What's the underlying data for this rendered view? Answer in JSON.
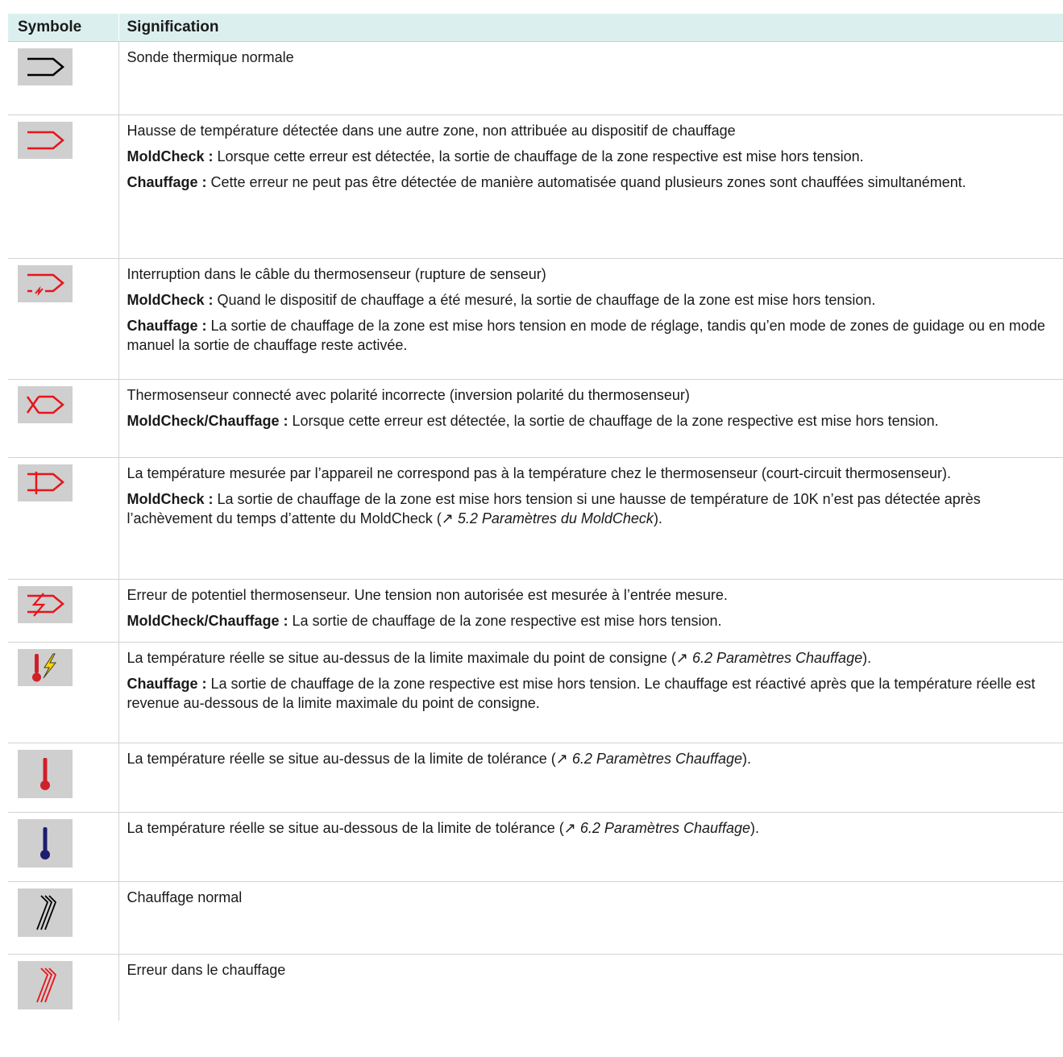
{
  "header": {
    "symbol": "Symbole",
    "meaning": "Signification"
  },
  "rows": [
    {
      "icon": "thermocouple-normal-icon",
      "color": "#000000",
      "text": "Sonde thermique normale"
    },
    {
      "icon": "thermocouple-red-icon",
      "color": "#e8141b",
      "text": "Hausse de température détectée dans une autre zone, non attribuée au dispositif de chauffage",
      "p2_label": "MoldCheck :",
      "p2_text": " Lorsque cette erreur est détectée, la sortie de chauffage de la zone respective est mise hors tension.",
      "p3_label": "Chauffage :",
      "p3_text": " Cette erreur ne peut pas être détectée de manière automatisée quand plusieurs zones sont chauffées simultanément."
    },
    {
      "icon": "sensor-break-icon",
      "text": "Interruption dans le câble du thermosenseur (rupture de senseur)",
      "p2_label": "MoldCheck :",
      "p2_text": " Quand le dispositif de chauffage a été mesuré, la sortie de chauffage de la zone est mise hors tension.",
      "p3_label": "Chauffage :",
      "p3_text": " La sortie de chauffage de la zone est mise hors tension en mode de réglage, tandis qu’en mode de zones de guidage ou en mode manuel la sortie de chauffage reste activée."
    },
    {
      "icon": "polarity-reversed-icon",
      "text": "Thermosenseur connecté avec polarité incorrecte (inversion polarité du thermosenseur)",
      "p2_label": "MoldCheck/Chauffage :",
      "p2_text": " Lorsque cette erreur est détectée, la sortie de chauffage de la zone respective est mise hors tension."
    },
    {
      "icon": "short-circuit-icon",
      "text": "La température mesurée par l’appareil ne correspond pas à la température chez le thermosenseur (court-circuit thermosenseur).",
      "p2_label": "MoldCheck :",
      "p2_text_a": " La sortie de chauffage de la zone est mise hors tension si une hausse de température de 10K n’est pas détectée après l’achèvement du temps d’attente du MoldCheck (",
      "arrow": "↗",
      "p2_ref": " 5.2 Paramètres du MoldCheck",
      "p2_text_b": ")."
    },
    {
      "icon": "potential-error-icon",
      "text": "Erreur de potentiel thermosenseur. Une tension non autorisée est mesurée à l’entrée mesure.",
      "p2_label": "MoldCheck/Chauffage :",
      "p2_text": " La sortie de chauffage de la zone respective est mise hors tension."
    },
    {
      "icon": "over-temp-limit-icon",
      "text_a": "La température réelle se situe au-dessus de la limite maximale du point de consigne (",
      "arrow": "↗",
      "ref": " 6.2 Paramètres Chauffage",
      "text_b": ").",
      "p2_label": "Chauffage :",
      "p2_text": " La sortie de chauffage de la zone respective est mise hors tension. Le chauffage est réactivé après que la température réelle est revenue au-dessous de la limite maximale du point de consigne."
    },
    {
      "icon": "thermometer-high-icon",
      "color": "#d0202a",
      "text_a": "La température réelle se situe au-dessus de la limite de tolérance (",
      "arrow": "↗",
      "ref": " 6.2 Paramètres Chauffage",
      "text_b": ")."
    },
    {
      "icon": "thermometer-low-icon",
      "color": "#1e1e6e",
      "text_a": "La température réelle se situe au-dessous de la limite de tolérance (",
      "arrow": "↗",
      "ref": " 6.2 Paramètres Chauffage",
      "text_b": ")."
    },
    {
      "icon": "heater-normal-icon",
      "color": "#000000",
      "text": "Chauffage normal"
    },
    {
      "icon": "heater-error-icon",
      "color": "#e8141b",
      "text": "Erreur dans le chauffage"
    }
  ]
}
